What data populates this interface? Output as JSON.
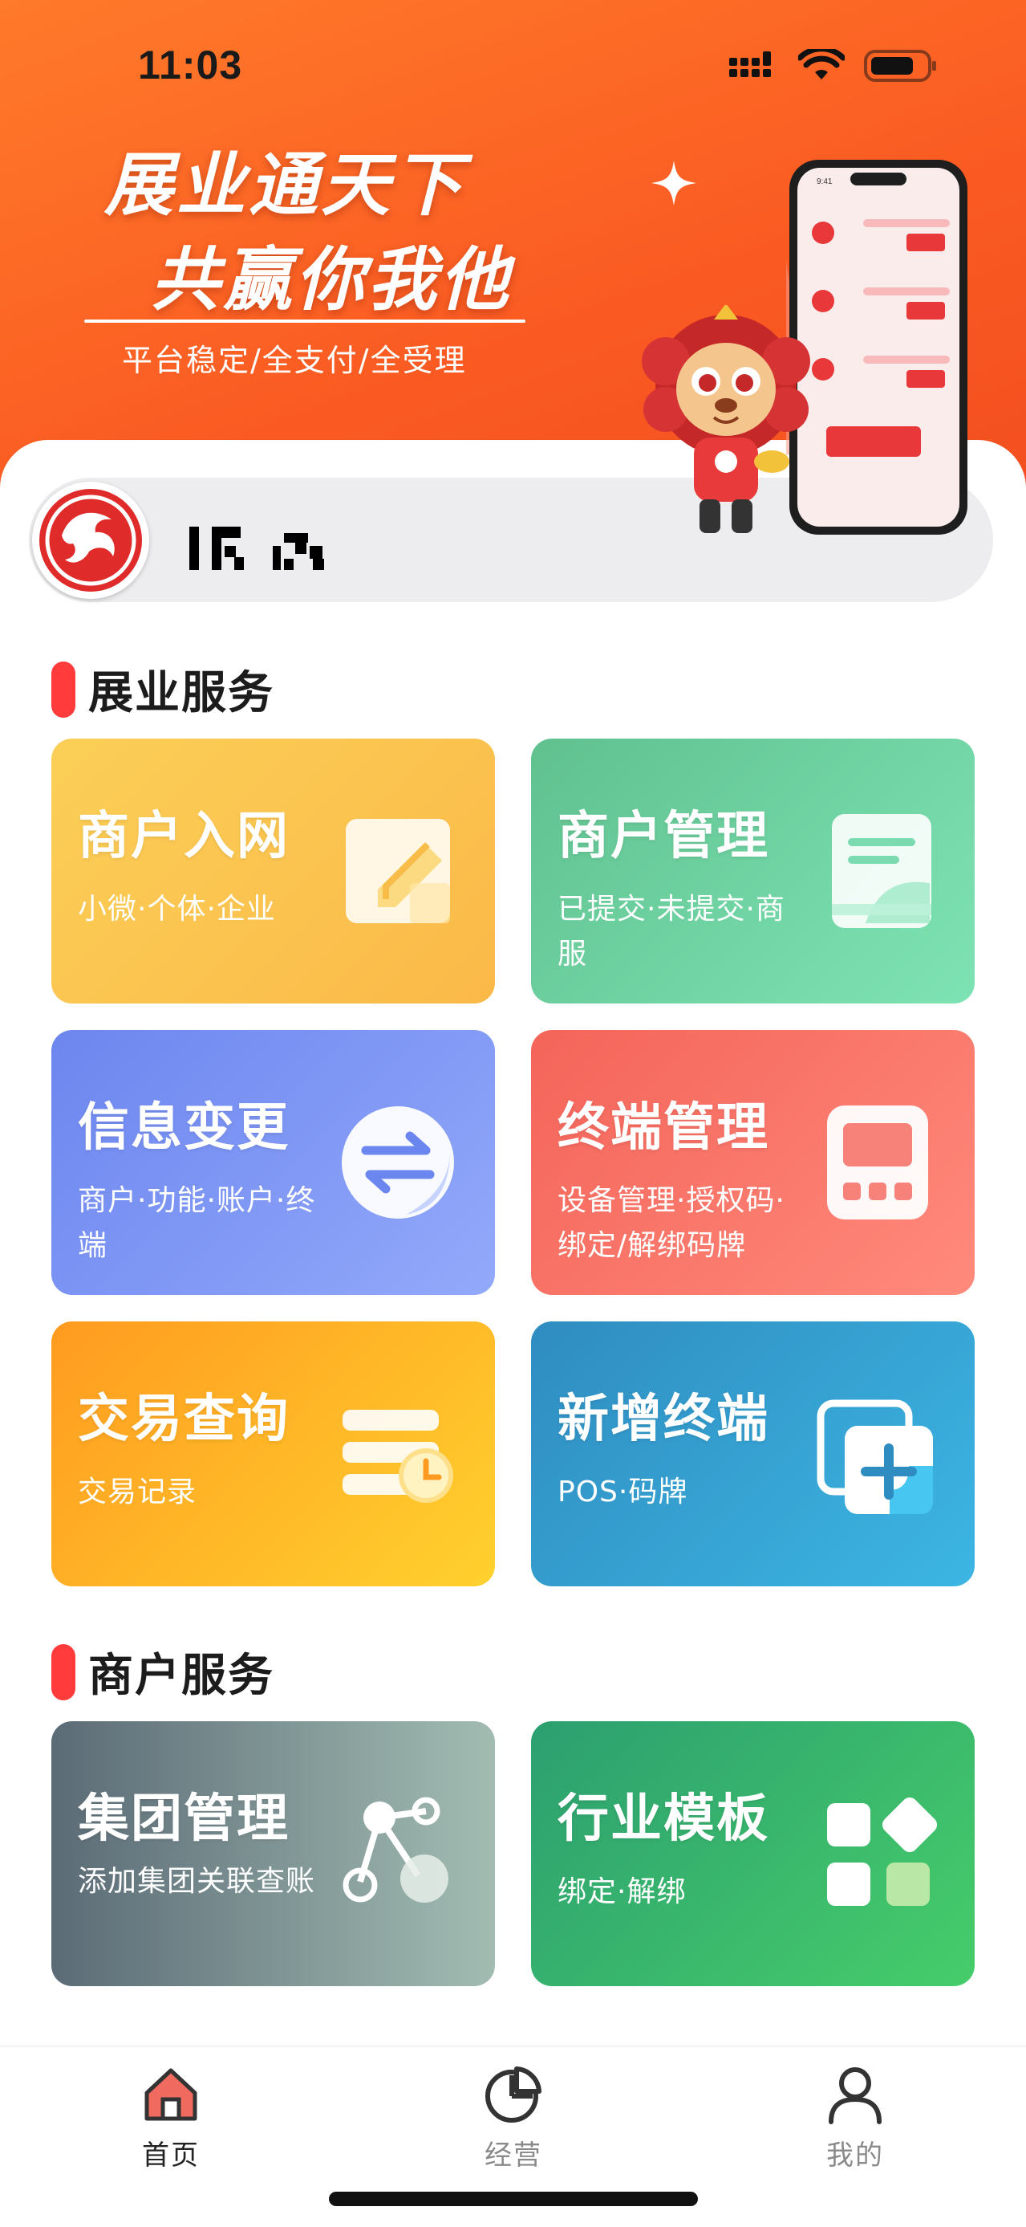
{
  "status_bar": {
    "time": "11:03"
  },
  "banner": {
    "slogan_line1": "展业通天下",
    "slogan_line2": "共赢你我他",
    "subtitle": "平台稳定/全支付/全受理"
  },
  "sections": {
    "business": "展业服务",
    "merchant": "商户服务"
  },
  "tiles": [
    {
      "title": "商户入网",
      "subtitle": "小微·个体·企业",
      "icon": "edit-document-icon"
    },
    {
      "title": "商户管理",
      "subtitle": "已提交·未提交·商服",
      "icon": "book-icon"
    },
    {
      "title": "信息变更",
      "subtitle": "商户·功能·账户·终端",
      "icon": "swap-arrows-icon"
    },
    {
      "title": "终端管理",
      "subtitle": "设备管理·授权码·绑定/解绑码牌",
      "icon": "pos-terminal-icon"
    },
    {
      "title": "交易查询",
      "subtitle": "交易记录",
      "icon": "records-clock-icon"
    },
    {
      "title": "新增终端",
      "subtitle": "POS·码牌",
      "icon": "add-copy-icon"
    },
    {
      "title": "集团管理",
      "subtitle": "添加集团关联查账",
      "icon": "network-nodes-icon"
    },
    {
      "title": "行业模板",
      "subtitle": "绑定·解绑",
      "icon": "template-grid-icon"
    }
  ],
  "tabbar": {
    "items": [
      {
        "label": "首页",
        "icon": "home-icon",
        "active": true
      },
      {
        "label": "经营",
        "icon": "pie-chart-icon",
        "active": false
      },
      {
        "label": "我的",
        "icon": "user-icon",
        "active": false
      }
    ]
  },
  "colors": {
    "header": "#fa5a22",
    "accent_red": "#ff3b3b",
    "tab_active": "#e8453c",
    "tab_inactive": "#8a8a8a"
  }
}
